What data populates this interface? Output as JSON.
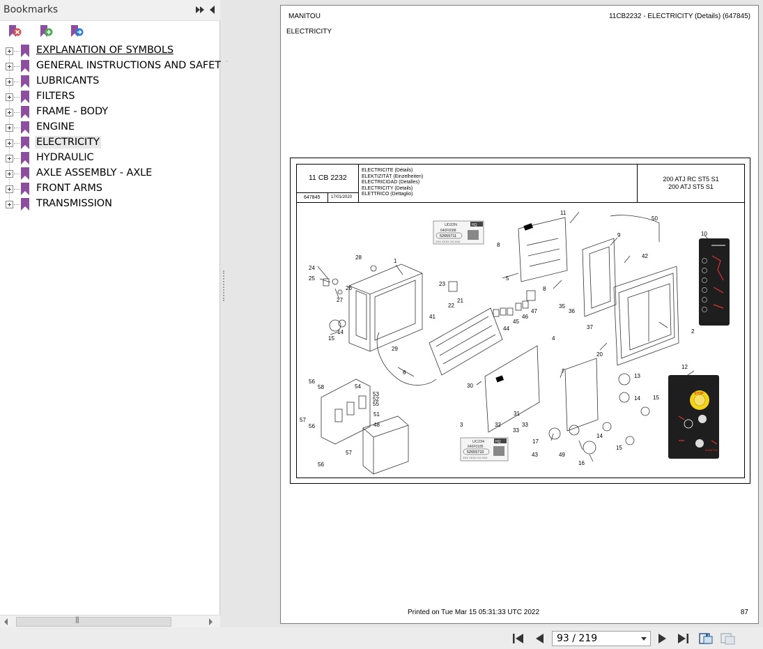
{
  "sidebar": {
    "title": "Bookmarks",
    "bookmarks": [
      {
        "label": "EXPLANATION OF SYMBOLS"
      },
      {
        "label": "GENERAL INSTRUCTIONS AND SAFETY"
      },
      {
        "label": "LUBRICANTS"
      },
      {
        "label": "FILTERS"
      },
      {
        "label": "FRAME - BODY"
      },
      {
        "label": "ENGINE"
      },
      {
        "label": "ELECTRICITY"
      },
      {
        "label": "HYDRAULIC"
      },
      {
        "label": "AXLE ASSEMBLY - AXLE"
      },
      {
        "label": "FRONT ARMS"
      },
      {
        "label": "TRANSMISSION"
      }
    ],
    "selected_index": 6,
    "icons": {
      "delete": "bookmark-delete-icon",
      "add": "bookmark-add-icon",
      "go": "bookmark-go-icon"
    }
  },
  "document": {
    "header_left": "MANITOU",
    "header_right": "11CB2232 - ELECTRICITY (Details) (647845)",
    "section": "ELECTRICITY",
    "title_block": {
      "code": "11 CB 2232",
      "ref": "647845",
      "date": "17/01/2020",
      "names": [
        "ELECTRICITE (Détails)",
        "ELEKTIZITÄT (Einzelheiten)",
        "ELECTRICIDAD (Detalles)",
        "ELECTRICITY (Details)",
        "ELETTRICO (Dettaglio)"
      ],
      "models": [
        "200 ATJ RC ST5 S1",
        "200 ATJ ST5 S1"
      ]
    },
    "part_labels": {
      "label_a_code": "UD22N",
      "label_a_brand": "HQ",
      "label_a_ref": "640F0088",
      "label_a_number": "52655711",
      "label_a_serial": "XXX XXXX XX-XXX",
      "label_b_code": "UC234",
      "label_b_brand": "HQ",
      "label_b_ref": "640F0185",
      "label_b_number": "52655710",
      "label_b_serial": "XXX XXXX XX-XXX",
      "stop_text": "STOP",
      "brand": "MANITOU"
    },
    "callouts": [
      "1",
      "2",
      "3",
      "4",
      "5",
      "6",
      "7",
      "8",
      "8",
      "9",
      "10",
      "11",
      "12",
      "13",
      "14",
      "14",
      "14",
      "15",
      "15",
      "15",
      "16",
      "17",
      "20",
      "21",
      "22",
      "23",
      "24",
      "25",
      "26",
      "27",
      "28",
      "29",
      "30",
      "31",
      "32",
      "33",
      "33",
      "35",
      "36",
      "37",
      "41",
      "42",
      "43",
      "44",
      "45",
      "46",
      "47",
      "48",
      "49",
      "50",
      "51",
      "52",
      "53",
      "54",
      "55",
      "56",
      "56",
      "56",
      "57",
      "57",
      "58"
    ],
    "footer_printed": "Printed on  Tue Mar 15 05:31:33 UTC 2022",
    "page_number": "87"
  },
  "navigation": {
    "page_display": "93 / 219",
    "first_icon": "first-page-icon",
    "prev_icon": "previous-page-icon",
    "next_icon": "next-page-icon",
    "last_icon": "last-page-icon"
  },
  "colors": {
    "bookmark_flag": "#8b4f9e",
    "selected_bg": "#e8e8e8",
    "nav_blue": "#2a5d8f"
  }
}
